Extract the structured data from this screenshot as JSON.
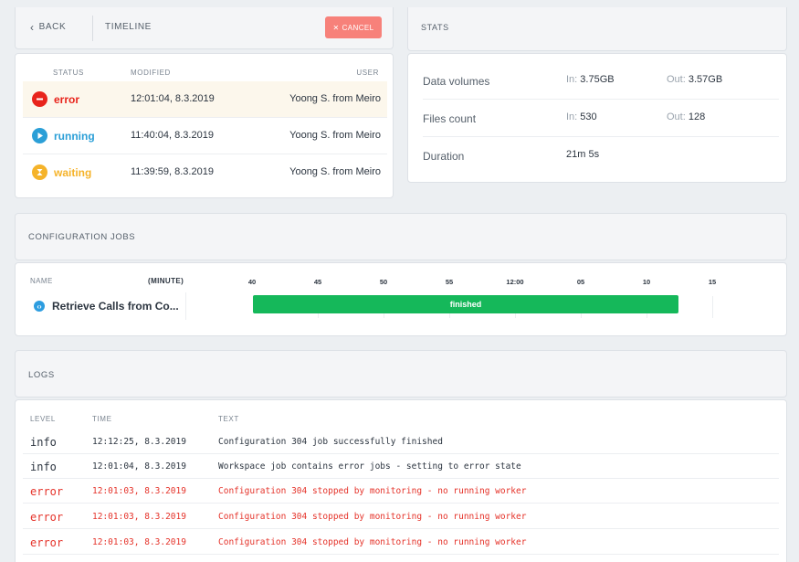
{
  "timeline": {
    "back_label": "BACK",
    "title": "TIMELINE",
    "cancel_label": "CANCEL",
    "columns": {
      "status": "STATUS",
      "modified": "MODIFIED",
      "user": "USER"
    },
    "rows": [
      {
        "status": "error",
        "modified": "12:01:04, 8.3.2019",
        "user": "Yoong S. from Meiro",
        "color": "#e8241c",
        "icon": "minus-circle-icon"
      },
      {
        "status": "running",
        "modified": "11:40:04, 8.3.2019",
        "user": "Yoong S. from Meiro",
        "color": "#2b9fd7",
        "icon": "play-circle-icon"
      },
      {
        "status": "waiting",
        "modified": "11:39:59, 8.3.2019",
        "user": "Yoong S. from Meiro",
        "color": "#f5b32a",
        "icon": "hourglass-icon"
      }
    ]
  },
  "stats": {
    "title": "STATS",
    "rows": [
      {
        "label": "Data volumes",
        "in_prefix": "In:",
        "in_value": "3.75GB",
        "out_prefix": "Out:",
        "out_value": "3.57GB"
      },
      {
        "label": "Files count",
        "in_prefix": "In:",
        "in_value": "530",
        "out_prefix": "Out:",
        "out_value": "128"
      },
      {
        "label": "Duration",
        "in_prefix": "",
        "in_value": "21m 5s",
        "out_prefix": "",
        "out_value": ""
      }
    ]
  },
  "config_jobs": {
    "title": "CONFIGURATION JOBS",
    "name_header": "NAME",
    "unit_header": "(MINUTE)",
    "ticks": [
      "40",
      "45",
      "50",
      "55",
      "12:00",
      "05",
      "10",
      "15"
    ],
    "job": {
      "name": "Retrieve Calls from Co...",
      "status": "finished",
      "status_color": "#15b85a",
      "progress": 1.0
    }
  },
  "logs": {
    "title": "LOGS",
    "columns": {
      "level": "LEVEL",
      "time": "TIME",
      "text": "TEXT"
    },
    "rows": [
      {
        "level": "info",
        "time": "12:12:25, 8.3.2019",
        "text": "Configuration 304 job successfully finished"
      },
      {
        "level": "info",
        "time": "12:01:04, 8.3.2019",
        "text": "Workspace job contains error jobs - setting to error state"
      },
      {
        "level": "error",
        "time": "12:01:03, 8.3.2019",
        "text": "Configuration 304 stopped by monitoring - no running worker"
      },
      {
        "level": "error",
        "time": "12:01:03, 8.3.2019",
        "text": "Configuration 304 stopped by monitoring - no running worker"
      },
      {
        "level": "error",
        "time": "12:01:03, 8.3.2019",
        "text": "Configuration 304 stopped by monitoring - no running worker"
      }
    ]
  },
  "colors": {
    "accent_red": "#f7817a",
    "error": "#e5332a",
    "success": "#15b85a"
  }
}
